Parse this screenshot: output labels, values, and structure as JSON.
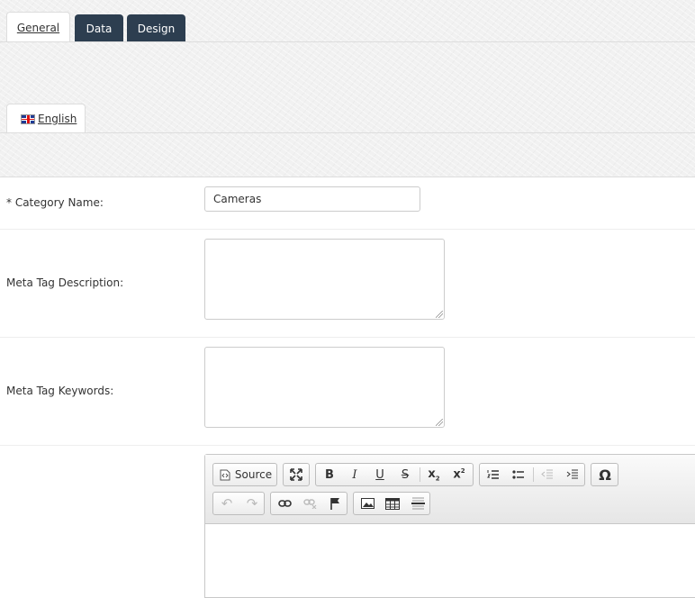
{
  "tabs": [
    {
      "label": "General",
      "active": true
    },
    {
      "label": "Data",
      "active": false
    },
    {
      "label": "Design",
      "active": false
    }
  ],
  "language_tab": {
    "label": "English",
    "flag": "uk-flag-icon"
  },
  "form": {
    "category_name_label": "* Category Name:",
    "category_name_value": "Cameras",
    "meta_description_label": "Meta Tag Description:",
    "meta_description_value": "",
    "meta_keywords_label": "Meta Tag Keywords:",
    "meta_keywords_value": ""
  },
  "editor": {
    "source_label": "Source",
    "toolbar_icons": [
      "source-icon",
      "maximize-icon",
      "bold-icon",
      "italic-icon",
      "underline-icon",
      "strikethrough-icon",
      "subscript-icon",
      "superscript-icon",
      "numbered-list-icon",
      "bulleted-list-icon",
      "outdent-icon",
      "indent-icon",
      "special-char-icon",
      "undo-icon",
      "redo-icon",
      "link-icon",
      "unlink-icon",
      "anchor-icon",
      "image-icon",
      "table-icon",
      "horizontal-rule-icon"
    ]
  },
  "colors": {
    "tab_dark": "#2d3e50",
    "border": "#dddddd"
  }
}
